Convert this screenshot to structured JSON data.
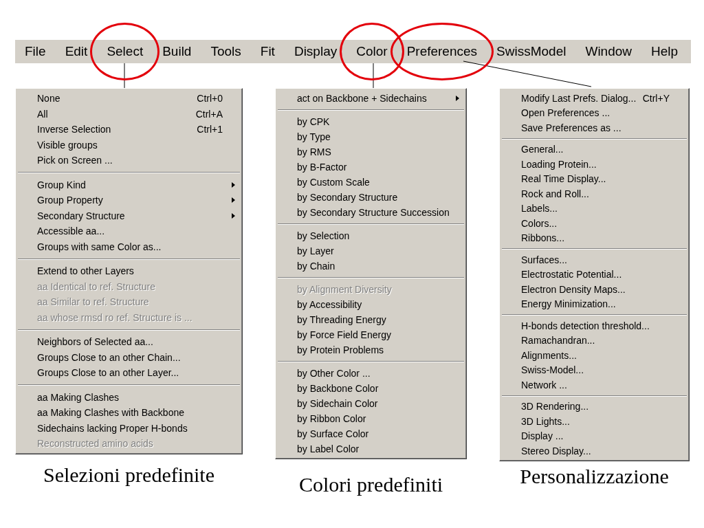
{
  "menubar": {
    "items": [
      {
        "label": "File",
        "circled": false
      },
      {
        "label": "Edit",
        "circled": false
      },
      {
        "label": "Select",
        "circled": true
      },
      {
        "label": "Build",
        "circled": false
      },
      {
        "label": "Tools",
        "circled": false
      },
      {
        "label": "Fit",
        "circled": false
      },
      {
        "label": "Display",
        "circled": false
      },
      {
        "label": "Color",
        "circled": true
      },
      {
        "label": "Preferences",
        "circled": true
      },
      {
        "label": "SwissModel",
        "circled": false
      },
      {
        "label": "Window",
        "circled": false
      },
      {
        "label": "Help",
        "circled": false
      }
    ]
  },
  "menus": [
    {
      "groups": [
        {
          "items": [
            {
              "label": "None",
              "shortcut": "Ctrl+0",
              "submenu": false,
              "disabled": false
            },
            {
              "label": "All",
              "shortcut": "Ctrl+A",
              "submenu": false,
              "disabled": false
            },
            {
              "label": "Inverse Selection",
              "shortcut": "Ctrl+1",
              "submenu": false,
              "disabled": false
            },
            {
              "label": "Visible groups",
              "submenu": false,
              "disabled": false
            },
            {
              "label": "Pick on Screen ...",
              "submenu": false,
              "disabled": false
            }
          ]
        },
        {
          "items": [
            {
              "label": "Group Kind",
              "submenu": true,
              "disabled": false
            },
            {
              "label": "Group Property",
              "submenu": true,
              "disabled": false
            },
            {
              "label": "Secondary Structure",
              "submenu": true,
              "disabled": false
            },
            {
              "label": "Accessible aa...",
              "submenu": false,
              "disabled": false
            },
            {
              "label": "Groups with same Color as...",
              "submenu": false,
              "disabled": false
            }
          ]
        },
        {
          "items": [
            {
              "label": "Extend to other Layers",
              "submenu": false,
              "disabled": false
            },
            {
              "label": "aa Identical to ref. Structure",
              "submenu": false,
              "disabled": true
            },
            {
              "label": "aa Similar to ref. Structure",
              "submenu": false,
              "disabled": true
            },
            {
              "label": "aa whose rmsd ro ref. Structure is ...",
              "submenu": false,
              "disabled": true
            }
          ]
        },
        {
          "items": [
            {
              "label": "Neighbors of Selected aa...",
              "submenu": false,
              "disabled": false
            },
            {
              "label": "Groups Close to an other Chain...",
              "submenu": false,
              "disabled": false
            },
            {
              "label": "Groups Close to an other Layer...",
              "submenu": false,
              "disabled": false
            }
          ]
        },
        {
          "items": [
            {
              "label": "aa Making Clashes",
              "submenu": false,
              "disabled": false
            },
            {
              "label": "aa Making Clashes with Backbone",
              "submenu": false,
              "disabled": false
            },
            {
              "label": "Sidechains lacking Proper H-bonds",
              "submenu": false,
              "disabled": false
            },
            {
              "label": "Reconstructed amino acids",
              "submenu": false,
              "disabled": true
            }
          ]
        }
      ],
      "caption": "Selezioni predefinite"
    },
    {
      "groups": [
        {
          "items": [
            {
              "label": "act on Backbone + Sidechains",
              "submenu": true,
              "disabled": false
            }
          ]
        },
        {
          "items": [
            {
              "label": "by CPK",
              "submenu": false,
              "disabled": false
            },
            {
              "label": "by Type",
              "submenu": false,
              "disabled": false
            },
            {
              "label": "by RMS",
              "submenu": false,
              "disabled": false
            },
            {
              "label": "by B-Factor",
              "submenu": false,
              "disabled": false
            },
            {
              "label": "by Custom Scale",
              "submenu": false,
              "disabled": false
            },
            {
              "label": "by Secondary Structure",
              "submenu": false,
              "disabled": false
            },
            {
              "label": "by Secondary Structure Succession",
              "submenu": false,
              "disabled": false
            }
          ]
        },
        {
          "items": [
            {
              "label": "by Selection",
              "submenu": false,
              "disabled": false
            },
            {
              "label": "by Layer",
              "submenu": false,
              "disabled": false
            },
            {
              "label": "by Chain",
              "submenu": false,
              "disabled": false
            }
          ]
        },
        {
          "items": [
            {
              "label": "by Alignment Diversity",
              "submenu": false,
              "disabled": true
            },
            {
              "label": "by Accessibility",
              "submenu": false,
              "disabled": false
            },
            {
              "label": "by Threading Energy",
              "submenu": false,
              "disabled": false
            },
            {
              "label": "by Force Field Energy",
              "submenu": false,
              "disabled": false
            },
            {
              "label": "by Protein Problems",
              "submenu": false,
              "disabled": false
            }
          ]
        },
        {
          "items": [
            {
              "label": "by Other Color ...",
              "submenu": false,
              "disabled": false
            },
            {
              "label": "by Backbone Color",
              "submenu": false,
              "disabled": false
            },
            {
              "label": "by Sidechain Color",
              "submenu": false,
              "disabled": false
            },
            {
              "label": "by Ribbon Color",
              "submenu": false,
              "disabled": false
            },
            {
              "label": "by Surface Color",
              "submenu": false,
              "disabled": false
            },
            {
              "label": "by Label Color",
              "submenu": false,
              "disabled": false
            }
          ]
        }
      ],
      "caption": "Colori predefiniti"
    },
    {
      "groups": [
        {
          "items": [
            {
              "label": "Modify Last Prefs. Dialog...",
              "shortcut": "Ctrl+Y",
              "submenu": false,
              "disabled": false
            },
            {
              "label": "Open Preferences ...",
              "submenu": false,
              "disabled": false
            },
            {
              "label": "Save Preferences as ...",
              "submenu": false,
              "disabled": false
            }
          ]
        },
        {
          "items": [
            {
              "label": "General...",
              "submenu": false,
              "disabled": false
            },
            {
              "label": "Loading Protein...",
              "submenu": false,
              "disabled": false
            },
            {
              "label": "Real Time Display...",
              "submenu": false,
              "disabled": false
            },
            {
              "label": "Rock and Roll...",
              "submenu": false,
              "disabled": false
            },
            {
              "label": "Labels...",
              "submenu": false,
              "disabled": false
            },
            {
              "label": "Colors...",
              "submenu": false,
              "disabled": false
            },
            {
              "label": "Ribbons...",
              "submenu": false,
              "disabled": false
            }
          ]
        },
        {
          "items": [
            {
              "label": "Surfaces...",
              "submenu": false,
              "disabled": false
            },
            {
              "label": "Electrostatic Potential...",
              "submenu": false,
              "disabled": false
            },
            {
              "label": "Electron Density Maps...",
              "submenu": false,
              "disabled": false
            },
            {
              "label": "Energy Minimization...",
              "submenu": false,
              "disabled": false
            }
          ]
        },
        {
          "items": [
            {
              "label": "H-bonds detection threshold...",
              "submenu": false,
              "disabled": false
            },
            {
              "label": "Ramachandran...",
              "submenu": false,
              "disabled": false
            },
            {
              "label": "Alignments...",
              "submenu": false,
              "disabled": false
            },
            {
              "label": "Swiss-Model...",
              "submenu": false,
              "disabled": false
            },
            {
              "label": "Network ...",
              "submenu": false,
              "disabled": false
            }
          ]
        },
        {
          "items": [
            {
              "label": "3D Rendering...",
              "submenu": false,
              "disabled": false
            },
            {
              "label": "3D Lights...",
              "submenu": false,
              "disabled": false
            },
            {
              "label": "Display ...",
              "submenu": false,
              "disabled": false
            },
            {
              "label": "Stereo Display...",
              "submenu": false,
              "disabled": false
            }
          ]
        }
      ],
      "caption": "Personalizzazione"
    }
  ]
}
